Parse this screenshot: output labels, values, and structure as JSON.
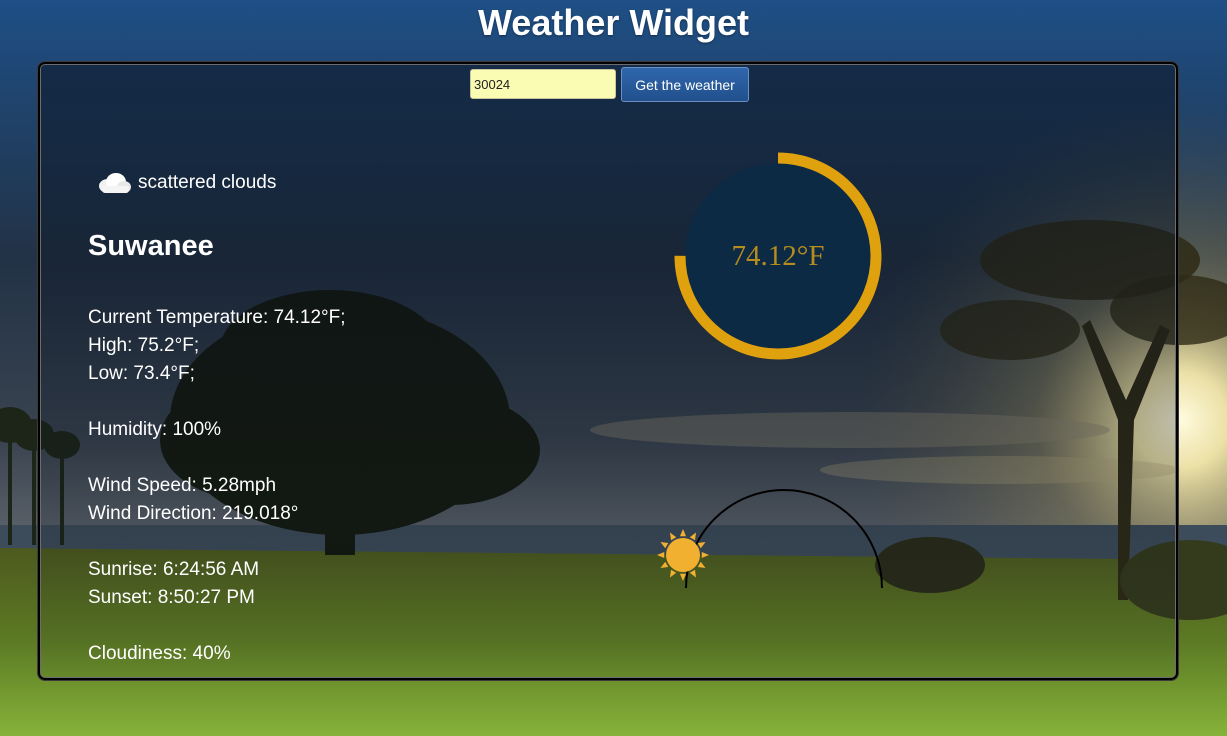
{
  "page": {
    "title": "Weather Widget"
  },
  "search": {
    "zip_value": "30024",
    "button_label": "Get the weather"
  },
  "weather": {
    "icon": "cloud-icon",
    "description": "scattered clouds",
    "city": "Suwanee",
    "current_temperature": "Current Temperature: 74.12°F;",
    "high": "High: 75.2°F;",
    "low": "Low: 73.4°F;",
    "humidity": "Humidity: 100%",
    "wind_speed": "Wind Speed: 5.28mph",
    "wind_direction": "Wind Direction: 219.018°",
    "sunrise": "Sunrise: 6:24:56 AM",
    "sunset": "Sunset: 8:50:27 PM",
    "cloudiness": "Cloudiness: 40%"
  },
  "gauge": {
    "temp_label": "74.12°F",
    "fill_fraction": 0.75,
    "ring_color": "#e0a10e",
    "inner_color": "#0d2a45"
  },
  "sun": {
    "icon": "sun-icon",
    "day_progress": 0.0,
    "color": "#f2b030"
  }
}
